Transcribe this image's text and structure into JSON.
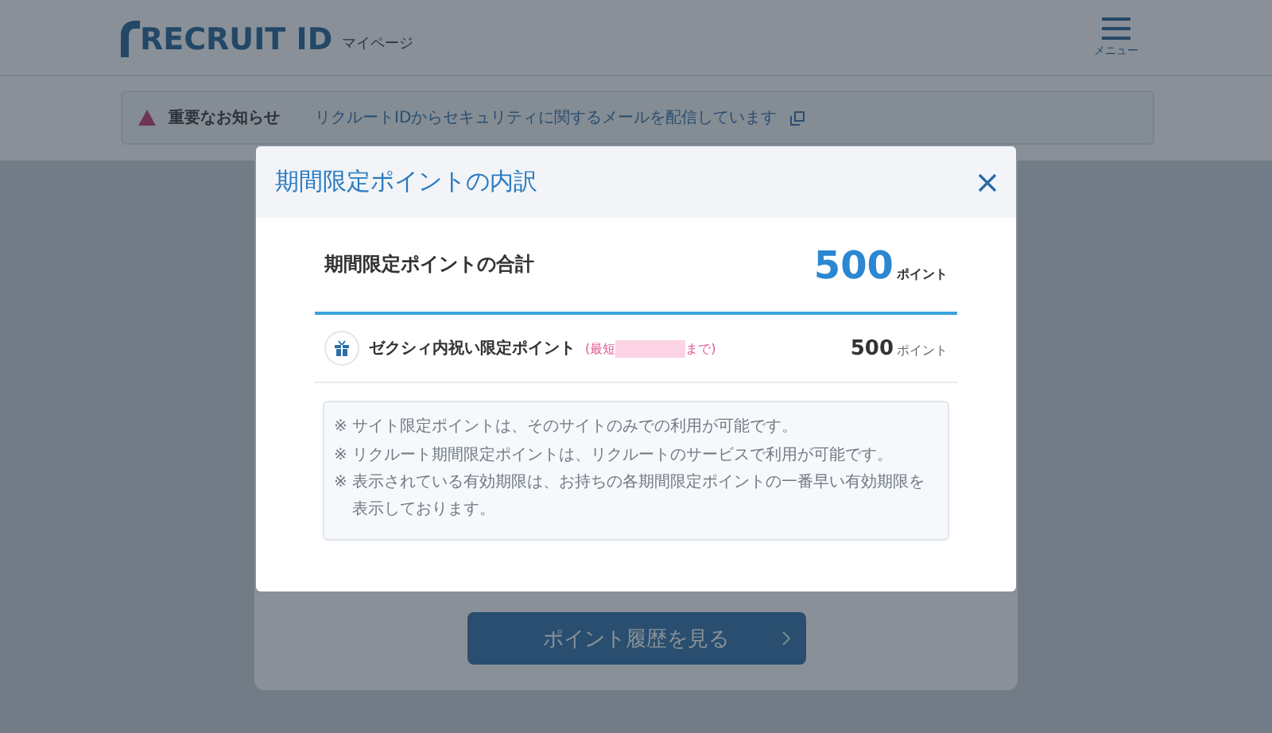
{
  "header": {
    "logo": "RECRUIT ID",
    "subtitle": "マイページ",
    "menu_label": "メニュー"
  },
  "notice": {
    "label": "重要なお知らせ",
    "link": "リクルートIDからセキュリティに関するメールを配信しています"
  },
  "history_button": "ポイント履歴を見る",
  "modal": {
    "title": "期間限定ポイントの内訳",
    "total_label": "期間限定ポイントの合計",
    "total_value": "500",
    "total_unit": "ポイント",
    "items": [
      {
        "name": "ゼクシィ内祝い限定ポイント",
        "expiry_prefix": "(最短",
        "expiry_suffix": "まで)",
        "value": "500",
        "unit": "ポイント"
      }
    ],
    "notes": [
      {
        "mark": "※",
        "text": "サイト限定ポイントは、そのサイトのみでの利用が可能です。"
      },
      {
        "mark": "※",
        "text": "リクルート期間限定ポイントは、リクルートのサービスで利用が可能です。"
      },
      {
        "mark": "※",
        "text": "表示されている有効期限は、お持ちの各期間限定ポイントの一番早い有効期限を表示しております。"
      }
    ]
  }
}
